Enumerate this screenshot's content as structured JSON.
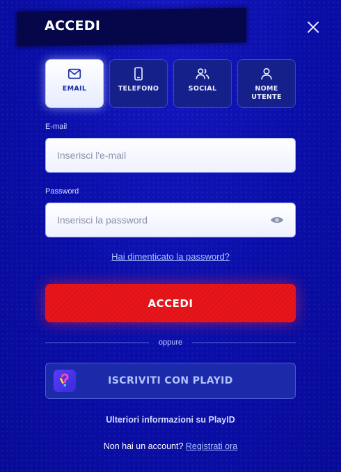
{
  "header": {
    "title": "ACCEDI",
    "close_icon": "close-icon"
  },
  "tabs": [
    {
      "label": "EMAIL",
      "icon": "envelope-icon",
      "active": true
    },
    {
      "label": "TELEFONO",
      "icon": "phone-icon",
      "active": false
    },
    {
      "label": "SOCIAL",
      "icon": "users-icon",
      "active": false
    },
    {
      "label": "NOME UTENTE",
      "icon": "user-icon",
      "active": false
    }
  ],
  "form": {
    "email_label": "E-mail",
    "email_placeholder": "Inserisci l'e-mail",
    "email_value": "",
    "password_label": "Password",
    "password_placeholder": "Inserisci la password",
    "password_value": "",
    "forgot_password": "Hai dimenticato la password?",
    "submit_label": "ACCEDI"
  },
  "divider_text": "oppure",
  "playid": {
    "button_label": "ISCRIVITI CON PLAYID",
    "logo_icon": "playid-logo-icon",
    "more_info": "Ulteriori informazioni su PlayID"
  },
  "footer": {
    "no_account_text": "Non hai un account?",
    "signup_link": "Registrati ora"
  },
  "colors": {
    "background": "#0a0ea8",
    "accent_red": "#e8161a",
    "link": "#a9c4ff"
  }
}
